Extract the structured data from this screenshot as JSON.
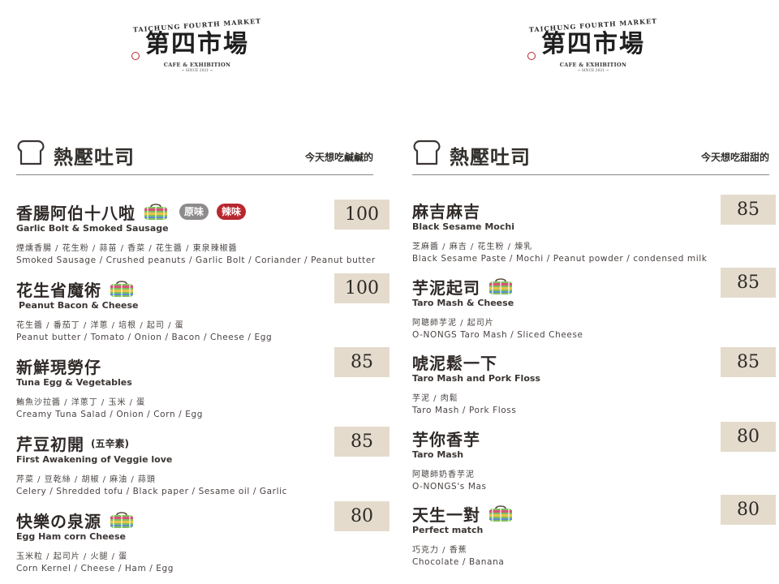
{
  "logo": {
    "arc": "TAICHUNG FOURTH MARKET",
    "main": "第四市場",
    "sub": "CAFE & EXHIBITION",
    "since": "~ SINCE 2021 ~"
  },
  "left": {
    "section_title": "熱壓吐司",
    "section_note": "今天想吃鹹鹹的",
    "items": [
      {
        "name": "香腸阿伯十八啦",
        "en": "Garlic Bolt & Smoked Sausage",
        "zh_ing": "煙燻香腸 / 花生粉 / 蒜苗 / 香菜 / 花生醬 / 東泉辣椒醬",
        "en_ing": "Smoked Sausage / Crushed peanuts / Garlic Bolt / Coriander / Peanut butter",
        "price": "100",
        "tag_original": "原味",
        "tag_spicy": "辣味"
      },
      {
        "name": "花生省魔術",
        "en": "Peanut Bacon & Cheese",
        "zh_ing": "花生醬 / 番茄丁 / 洋蔥 / 培根 / 起司 / 蛋",
        "en_ing": "Peanut butter / Tomato / Onion / Bacon / Cheese / Egg",
        "price": "100"
      },
      {
        "name": "新鮮現勞仔",
        "en": "Tuna Egg & Vegetables",
        "zh_ing": "鮪魚沙拉醬 / 洋蔥丁 / 玉米 / 蛋",
        "en_ing": "Creamy Tuna Salad / Onion / Corn / Egg",
        "price": "85"
      },
      {
        "name": "芹豆初開",
        "name_small": "(五辛素)",
        "en": "First Awakening of Veggie love",
        "zh_ing": "芹菜 / 豆乾絲 / 胡椒 / 麻油 / 蒜頭",
        "en_ing": "Celery / Shredded tofu / Black paper / Sesame oil / Garlic",
        "price": "85"
      },
      {
        "name": "快樂の泉源",
        "en": "Egg Ham corn Cheese",
        "zh_ing": "玉米粒 / 起司片 / 火腿 / 蛋",
        "en_ing": "Corn Kernel / Cheese / Ham / Egg",
        "price": "80"
      }
    ]
  },
  "right": {
    "section_title": "熱壓吐司",
    "section_note": "今天想吃甜甜的",
    "items": [
      {
        "name": "麻吉麻吉",
        "en": "Black Sesame Mochi",
        "zh_ing": "芝麻醬 / 麻吉 / 花生粉 / 煉乳",
        "en_ing": "Black Sesame Paste / Mochi / Peanut powder / condensed milk",
        "price": "85"
      },
      {
        "name": "芋泥起司",
        "en": "Taro Mash & Cheese",
        "zh_ing": "阿聰師芋泥 / 起司片",
        "en_ing": "O-NONGS Taro Mash / Sliced Cheese",
        "price": "85"
      },
      {
        "name": "唬泥鬆一下",
        "en": "Taro Mash and Pork Floss",
        "zh_ing": "芋泥 / 肉鬆",
        "en_ing": "Taro Mash / Pork Floss",
        "price": "85"
      },
      {
        "name": "芋你香芋",
        "en": "Taro Mash",
        "zh_ing": "阿聰師奶香芋泥",
        "en_ing": "O-NONGS's Mas",
        "price": "80"
      },
      {
        "name": "天生一對",
        "en": "Perfect match",
        "zh_ing": "巧克力 / 香蕉",
        "en_ing": "Chocolate / Banana",
        "price": "80"
      }
    ]
  },
  "colors": {
    "price_bg": "#e4dbcd",
    "tag_grey": "#8e8b8b",
    "tag_red": "#b8272f",
    "text": "#2f2a28"
  },
  "icons": [
    "toast-icon",
    "lunchbox-icon"
  ]
}
